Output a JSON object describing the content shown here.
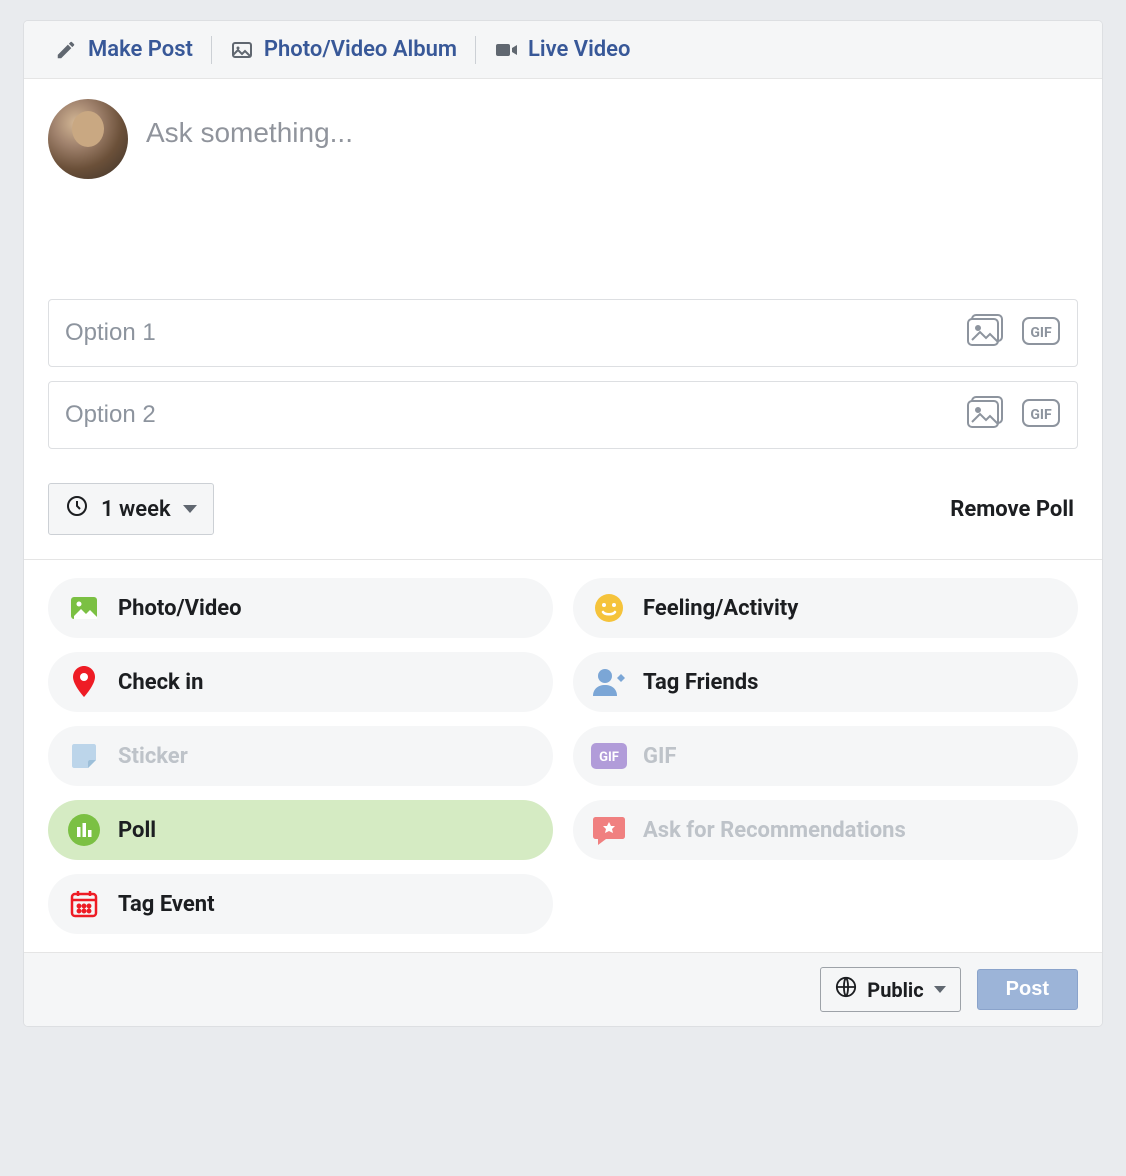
{
  "tabs": {
    "make_post": "Make Post",
    "photo_video_album": "Photo/Video Album",
    "live_video": "Live Video"
  },
  "compose": {
    "placeholder": "Ask something..."
  },
  "poll": {
    "option1_placeholder": "Option 1",
    "option2_placeholder": "Option 2",
    "duration": "1 week",
    "remove_label": "Remove Poll"
  },
  "attachments": {
    "photo_video": "Photo/Video",
    "feeling_activity": "Feeling/Activity",
    "check_in": "Check in",
    "tag_friends": "Tag Friends",
    "sticker": "Sticker",
    "gif": "GIF",
    "poll": "Poll",
    "ask_recommendations": "Ask for Recommendations",
    "tag_event": "Tag Event"
  },
  "footer": {
    "privacy": "Public",
    "post": "Post"
  },
  "colors": {
    "link": "#385898",
    "photo_icon": "#7bc043",
    "feeling_icon": "#f5c33b",
    "checkin_icon": "#ee1c25",
    "tagfriends_icon": "#7ba6d6",
    "sticker_icon": "#bcd5ea",
    "gif_icon": "#b19cd9",
    "poll_icon": "#7bc043",
    "rec_icon": "#f08080",
    "event_icon": "#ee1c25"
  }
}
